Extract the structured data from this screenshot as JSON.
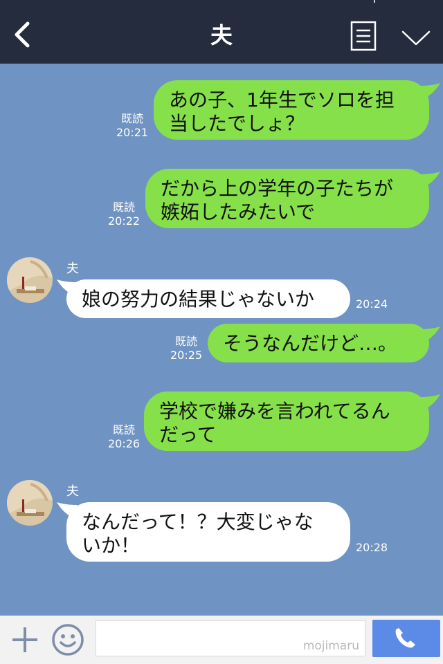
{
  "header": {
    "title": "夫",
    "back_icon": "chevron-left-icon",
    "menu_icon": "list-icon",
    "expand_icon": "chevron-down-icon"
  },
  "messages": [
    {
      "dir": "out",
      "text": "あの子、1年生でソロを担\n当したでしょ？",
      "read": "既読",
      "time": "20:21"
    },
    {
      "dir": "out",
      "text": "だから上の学年の子たちが\n嫉妬したみたいで",
      "read": "既読",
      "time": "20:22"
    },
    {
      "dir": "in",
      "sender": "夫",
      "text": "娘の努力の結果じゃないか",
      "time": "20:24"
    },
    {
      "dir": "out",
      "text": "そうなんだけど…。",
      "read": "既読",
      "time": "20:25"
    },
    {
      "dir": "out",
      "text": "学校で嫌みを言われてるん\nだって",
      "read": "既読",
      "time": "20:26"
    },
    {
      "dir": "in",
      "sender": "夫",
      "text": "なんだって！？大変じゃな\nいか！",
      "time": "20:28"
    }
  ],
  "footer": {
    "plus_icon": "plus-icon",
    "emoji_icon": "smiley-icon",
    "input_value": "",
    "watermark": "mojimaru",
    "call_icon": "phone-icon"
  },
  "colors": {
    "header_bg": "#252c3e",
    "chat_bg": "#6f93c2",
    "outgoing_bubble": "#86e04a",
    "incoming_bubble": "#ffffff",
    "call_button": "#5b8be6"
  }
}
